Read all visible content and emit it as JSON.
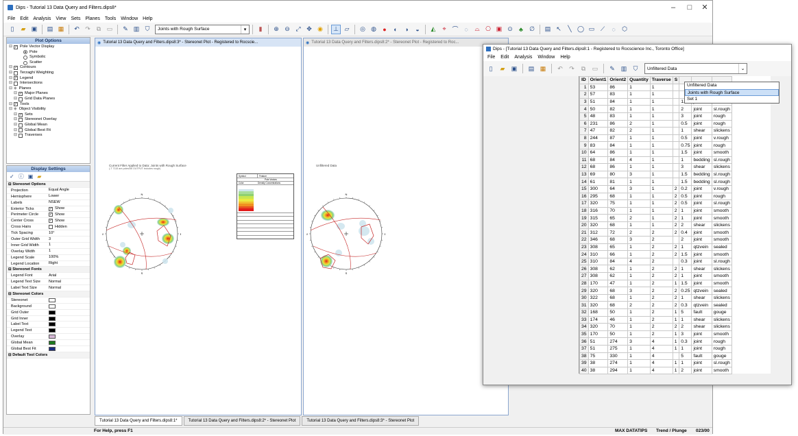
{
  "app": {
    "title": "Dips - Tutorial 13 Data Query and Filters.dips8*",
    "controls": [
      "–",
      "□",
      "✕"
    ]
  },
  "menu": [
    "File",
    "Edit",
    "Analysis",
    "View",
    "Sets",
    "Planes",
    "Tools",
    "Window",
    "Help"
  ],
  "toolbar": {
    "filter_value": "Joints with Rough Surface"
  },
  "plot_options": {
    "header": "Plot Options",
    "items": [
      {
        "t": "Pole Vector Display",
        "lvl": 0,
        "kind": "cb",
        "on": true
      },
      {
        "t": "Pole",
        "lvl": 2,
        "kind": "rb",
        "on": true
      },
      {
        "t": "Symbolic",
        "lvl": 2,
        "kind": "rb",
        "on": false
      },
      {
        "t": "Scatter",
        "lvl": 2,
        "kind": "rb",
        "on": false
      },
      {
        "t": "Contours",
        "lvl": 0,
        "kind": "cb",
        "on": true
      },
      {
        "t": "Terzaghi Weighting",
        "lvl": 0,
        "kind": "cb",
        "on": false
      },
      {
        "t": "Legend",
        "lvl": 0,
        "kind": "cb",
        "on": true
      },
      {
        "t": "Intersections",
        "lvl": 0,
        "kind": "cb",
        "on": false
      },
      {
        "t": "Planes",
        "lvl": 0,
        "kind": "none",
        "on": false
      },
      {
        "t": "Major Planes",
        "lvl": 1,
        "kind": "cb",
        "on": true
      },
      {
        "t": "Grid Data Planes",
        "lvl": 1,
        "kind": "cb",
        "on": false
      },
      {
        "t": "Tools",
        "lvl": 0,
        "kind": "cb",
        "on": true
      },
      {
        "t": "Object Visibility",
        "lvl": 0,
        "kind": "none",
        "on": false
      },
      {
        "t": "Sets",
        "lvl": 1,
        "kind": "cb",
        "on": true
      },
      {
        "t": "Stereonet Overlay",
        "lvl": 1,
        "kind": "cb",
        "on": false
      },
      {
        "t": "Global Mean",
        "lvl": 1,
        "kind": "cb",
        "on": false
      },
      {
        "t": "Global Best Fit",
        "lvl": 1,
        "kind": "cb",
        "on": false
      },
      {
        "t": "Traverses",
        "lvl": 1,
        "kind": "cb",
        "on": false
      }
    ]
  },
  "display_settings": {
    "header": "Display Settings",
    "rows": [
      {
        "sec": "Stereonet Options"
      },
      {
        "k": "Projection",
        "v": "Equal Angle"
      },
      {
        "k": "Hemisphere",
        "v": "Lower"
      },
      {
        "k": "Labels",
        "v": "NSEW"
      },
      {
        "k": "Exterior Ticks",
        "v": "Show",
        "cb": true
      },
      {
        "k": "Perimeter Circle",
        "v": "Show",
        "cb": true
      },
      {
        "k": "Center Cross",
        "v": "Show",
        "cb": true
      },
      {
        "k": "Cross Hairs",
        "v": "Hidden",
        "cb": false
      },
      {
        "k": "Tick Spacing",
        "v": "10°"
      },
      {
        "k": "Outer Grid Width",
        "v": "3"
      },
      {
        "k": "Inner Grid Width",
        "v": "1"
      },
      {
        "k": "Overlay Width",
        "v": "1"
      },
      {
        "k": "Legend Scale",
        "v": "100%"
      },
      {
        "k": "Legend Location",
        "v": "Right"
      },
      {
        "sec": "Stereonet Fonts"
      },
      {
        "k": "Legend Font",
        "v": "Arial"
      },
      {
        "k": "Legend Text Size",
        "v": "Normal"
      },
      {
        "k": "Label Text Size",
        "v": "Normal"
      },
      {
        "sec": "Stereonet Colors"
      },
      {
        "k": "Stereonet",
        "sw": "#ffffff"
      },
      {
        "k": "Background",
        "sw": "#ffffff"
      },
      {
        "k": "Grid Outer",
        "sw": "#000000"
      },
      {
        "k": "Grid Inner",
        "sw": "#000000"
      },
      {
        "k": "Label Text",
        "sw": "#000000"
      },
      {
        "k": "Legend Text",
        "sw": "#000000"
      },
      {
        "k": "Overlay",
        "sw": "#d7b8d7"
      },
      {
        "k": "Global Mean",
        "sw": "#1f7a1f"
      },
      {
        "k": "Global Best Fit",
        "sw": "#1a2a80"
      },
      {
        "sec": "Default Tool Colors"
      }
    ]
  },
  "doc1": {
    "title": "Tutorial 13 Data Query and Filters.dips8:3* - Stereonet Plot - Registered to Rocscie...",
    "caption1": "Current Filter Applied to Data: Joints with Rough Surface",
    "caption2": "(-T 7115 are poles/56 OUTPUT includes rough)"
  },
  "doc2": {
    "title": "Tutorial 13 Data Query and Filters.dips8:2* - Stereonet Plot - Registered to Roc...",
    "caption1": "Unfiltered Data"
  },
  "labels": {
    "n": "N",
    "s": "S",
    "e": "E",
    "w": "W"
  },
  "legend_head": {
    "symbol": "Symbol",
    "feature": "Feature",
    "pole": "Pole Vectors",
    "color": "Color",
    "density": "Density Concentrations"
  },
  "tabs": [
    "Tutorial 13 Data Query and Filters.dips8:1*",
    "Tutorial 13 Data Query and Filters.dips8:2* - Stereonet Plot",
    "Tutorial 13 Data Query and Filters.dips8:3* - Stereonet Plot"
  ],
  "status": {
    "help": "For Help, press F1",
    "mode": "MAX DATATIPS",
    "orient": "Trend / Plunge",
    "count": "023/00"
  },
  "grid_window": {
    "title": "Dips - [Tutorial 13 Data Query and Filters.dips8:1 - Registered to Rocscience Inc., Toronto Office]",
    "menu": [
      "File",
      "Edit",
      "Analysis",
      "Window",
      "Help"
    ],
    "filter_value": "Unfiltered Data",
    "dropdown": [
      "Unfiltered Data",
      "Joints with Rough Surface",
      "Set 1"
    ],
    "columns": [
      "ID",
      "Orient1",
      "Orient2",
      "Quantity",
      "Traverse",
      "S"
    ],
    "rows": [
      [
        "1",
        "53",
        "86",
        "1",
        "1",
        "",
        "",
        "",
        ""
      ],
      [
        "2",
        "57",
        "83",
        "1",
        "1",
        "",
        "",
        "",
        ""
      ],
      [
        "3",
        "51",
        "84",
        "1",
        "1",
        "",
        "1.5",
        "joint",
        "smooth"
      ],
      [
        "4",
        "50",
        "82",
        "1",
        "1",
        "",
        "2",
        "joint",
        "sl.rough"
      ],
      [
        "5",
        "48",
        "83",
        "1",
        "1",
        "",
        "3",
        "joint",
        "rough"
      ],
      [
        "6",
        "231",
        "86",
        "2",
        "1",
        "",
        "0.5",
        "joint",
        "rough"
      ],
      [
        "7",
        "47",
        "82",
        "2",
        "1",
        "",
        "1",
        "shear",
        "slickens"
      ],
      [
        "8",
        "244",
        "87",
        "1",
        "1",
        "",
        "0.5",
        "joint",
        "v.rough"
      ],
      [
        "9",
        "83",
        "84",
        "1",
        "1",
        "",
        "0.75",
        "joint",
        "rough"
      ],
      [
        "10",
        "64",
        "86",
        "1",
        "1",
        "",
        "1.5",
        "joint",
        "smooth"
      ],
      [
        "11",
        "68",
        "84",
        "4",
        "1",
        "",
        "1",
        "bedding",
        "sl.rough"
      ],
      [
        "12",
        "68",
        "86",
        "1",
        "1",
        "",
        "3",
        "shear",
        "slickens"
      ],
      [
        "13",
        "69",
        "80",
        "3",
        "1",
        "",
        "1.5",
        "bedding",
        "sl.rough"
      ],
      [
        "14",
        "61",
        "81",
        "1",
        "1",
        "",
        "1.5",
        "bedding",
        "sl.rough"
      ],
      [
        "15",
        "300",
        "64",
        "3",
        "1",
        "2",
        "0.2",
        "joint",
        "v.rough"
      ],
      [
        "16",
        "295",
        "68",
        "1",
        "1",
        "2",
        "0.5",
        "joint",
        "rough"
      ],
      [
        "17",
        "320",
        "75",
        "1",
        "1",
        "2",
        "0.5",
        "joint",
        "sl.rough"
      ],
      [
        "18",
        "316",
        "70",
        "1",
        "1",
        "2",
        "1",
        "joint",
        "smooth"
      ],
      [
        "19",
        "315",
        "65",
        "2",
        "1",
        "2",
        "1",
        "joint",
        "smooth"
      ],
      [
        "20",
        "320",
        "68",
        "1",
        "1",
        "2",
        "2",
        "shear",
        "slickens"
      ],
      [
        "21",
        "312",
        "72",
        "2",
        "2",
        "2",
        "0.4",
        "joint",
        "smooth"
      ],
      [
        "22",
        "346",
        "68",
        "3",
        "2",
        "",
        "2",
        "joint",
        "smooth"
      ],
      [
        "23",
        "308",
        "65",
        "1",
        "2",
        "2",
        "1",
        "qtzvein",
        "sealed"
      ],
      [
        "24",
        "310",
        "66",
        "1",
        "2",
        "2",
        "1.5",
        "joint",
        "smooth"
      ],
      [
        "25",
        "310",
        "84",
        "4",
        "2",
        "",
        "0.3",
        "joint",
        "sl.rough"
      ],
      [
        "26",
        "308",
        "62",
        "1",
        "2",
        "2",
        "1",
        "shear",
        "slickens"
      ],
      [
        "27",
        "308",
        "62",
        "1",
        "2",
        "2",
        "1",
        "joint",
        "smooth"
      ],
      [
        "28",
        "170",
        "47",
        "1",
        "2",
        "1",
        "1.5",
        "joint",
        "smooth"
      ],
      [
        "29",
        "320",
        "68",
        "3",
        "2",
        "2",
        "0.25",
        "qtzvein",
        "sealed"
      ],
      [
        "30",
        "322",
        "68",
        "1",
        "2",
        "2",
        "1",
        "shear",
        "slickens"
      ],
      [
        "31",
        "320",
        "68",
        "2",
        "2",
        "2",
        "0.3",
        "qtzvein",
        "sealed"
      ],
      [
        "32",
        "168",
        "50",
        "1",
        "2",
        "1",
        "5",
        "fault",
        "gouge"
      ],
      [
        "33",
        "174",
        "46",
        "1",
        "2",
        "1",
        "1",
        "shear",
        "slickens"
      ],
      [
        "34",
        "320",
        "70",
        "1",
        "2",
        "2",
        "2",
        "shear",
        "slickens"
      ],
      [
        "35",
        "170",
        "50",
        "1",
        "2",
        "1",
        "3",
        "joint",
        "smooth"
      ],
      [
        "36",
        "51",
        "274",
        "3",
        "4",
        "1",
        "0.3",
        "joint",
        "rough"
      ],
      [
        "37",
        "51",
        "275",
        "1",
        "4",
        "1",
        "1",
        "joint",
        "rough"
      ],
      [
        "38",
        "75",
        "330",
        "1",
        "4",
        "",
        "5",
        "fault",
        "gouge"
      ],
      [
        "39",
        "38",
        "274",
        "1",
        "4",
        "1",
        "1",
        "joint",
        "sl.rough"
      ],
      [
        "40",
        "38",
        "294",
        "1",
        "4",
        "1",
        "2",
        "joint",
        "smooth"
      ]
    ]
  }
}
